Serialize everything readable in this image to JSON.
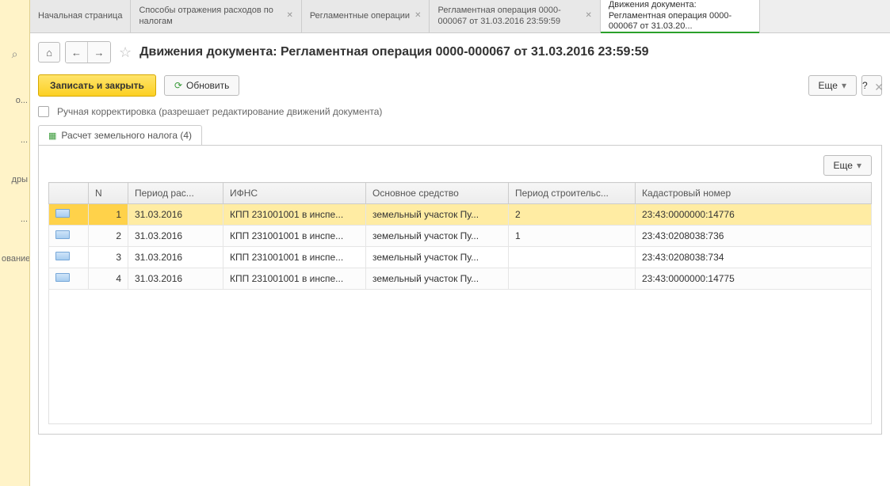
{
  "sidebar": {
    "items": [
      "о...",
      "...",
      "дры",
      "...",
      "ование"
    ]
  },
  "tabs": [
    {
      "label": "Начальная страница",
      "closable": false
    },
    {
      "label": "Способы отражения расходов по налогам",
      "closable": true
    },
    {
      "label": "Регламентные операции",
      "closable": true
    },
    {
      "label": "Регламентная операция 0000-000067 от 31.03.2016 23:59:59",
      "closable": true
    },
    {
      "label": "Движения документа: Регламентная операция 0000-000067 от 31.03.20...",
      "closable": false,
      "active": true
    }
  ],
  "page_title": "Движения документа: Регламентная операция 0000-000067 от 31.03.2016 23:59:59",
  "toolbar": {
    "save_close": "Записать и закрыть",
    "refresh": "Обновить",
    "more": "Еще",
    "help": "?"
  },
  "manual_edit_label": "Ручная корректировка (разрешает редактирование движений документа)",
  "sub_tab": "Расчет земельного налога (4)",
  "table": {
    "headers": {
      "n": "N",
      "period": "Период рас...",
      "ifns": "ИФНС",
      "asset": "Основное средство",
      "build": "Период строительс...",
      "cad": "Кадастровый номер"
    },
    "rows": [
      {
        "n": "1",
        "period": "31.03.2016",
        "ifns": "КПП 231001001 в инспе...",
        "asset": "земельный участок Пу...",
        "build": "2",
        "cad": "23:43:0000000:14776",
        "selected": true
      },
      {
        "n": "2",
        "period": "31.03.2016",
        "ifns": "КПП 231001001 в инспе...",
        "asset": "земельный участок Пу...",
        "build": "1",
        "cad": "23:43:0208038:736"
      },
      {
        "n": "3",
        "period": "31.03.2016",
        "ifns": "КПП 231001001 в инспе...",
        "asset": "земельный участок Пу...",
        "build": "",
        "cad": "23:43:0208038:734"
      },
      {
        "n": "4",
        "period": "31.03.2016",
        "ifns": "КПП 231001001 в инспе...",
        "asset": "земельный участок Пу...",
        "build": "",
        "cad": "23:43:0000000:14775"
      }
    ]
  }
}
